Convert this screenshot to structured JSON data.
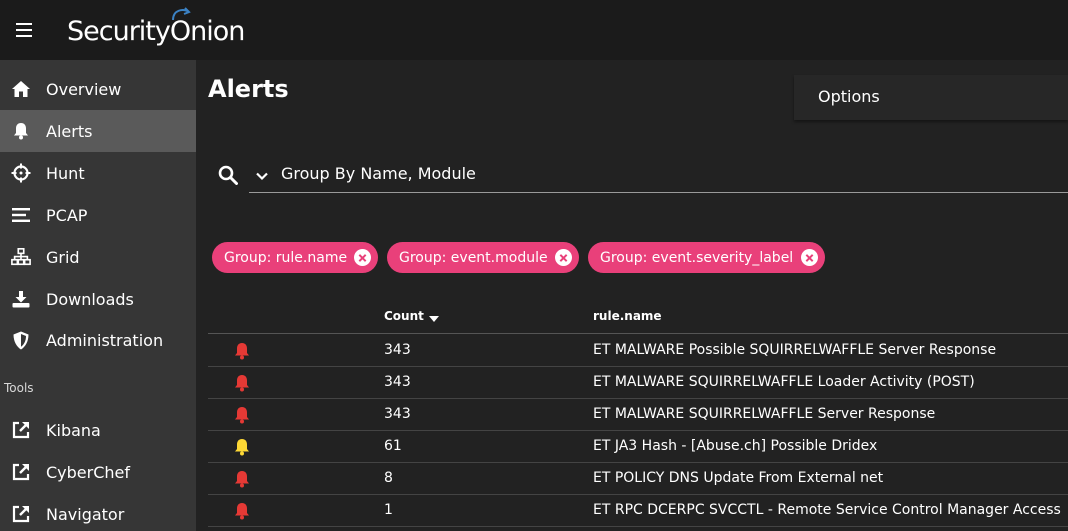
{
  "header": {
    "logo_text": "SecurityOnion",
    "menu_icon": "hamburger-menu-icon"
  },
  "sidebar": {
    "items": [
      {
        "label": "Overview",
        "icon": "home-icon"
      },
      {
        "label": "Alerts",
        "icon": "bell-icon",
        "active": true
      },
      {
        "label": "Hunt",
        "icon": "crosshair-icon"
      },
      {
        "label": "PCAP",
        "icon": "list-icon"
      },
      {
        "label": "Grid",
        "icon": "grid-network-icon"
      },
      {
        "label": "Downloads",
        "icon": "download-icon"
      },
      {
        "label": "Administration",
        "icon": "shield-icon"
      }
    ],
    "tools_label": "Tools",
    "tools": [
      {
        "label": "Kibana",
        "icon": "external-link-icon"
      },
      {
        "label": "CyberChef",
        "icon": "external-link-icon"
      },
      {
        "label": "Navigator",
        "icon": "external-link-icon"
      }
    ]
  },
  "main": {
    "title": "Alerts",
    "options_label": "Options",
    "query": "Group By Name, Module",
    "chips": [
      {
        "label": "Group: rule.name"
      },
      {
        "label": "Group: event.module"
      },
      {
        "label": "Group: event.severity_label"
      }
    ],
    "table": {
      "columns": {
        "count": "Count",
        "name": "rule.name"
      },
      "rows": [
        {
          "severity": "high",
          "count": "343",
          "name": "ET MALWARE Possible SQUIRRELWAFFLE Server Response"
        },
        {
          "severity": "high",
          "count": "343",
          "name": "ET MALWARE SQUIRRELWAFFLE Loader Activity (POST)"
        },
        {
          "severity": "high",
          "count": "343",
          "name": "ET MALWARE SQUIRRELWAFFLE Server Response"
        },
        {
          "severity": "medium",
          "count": "61",
          "name": "ET JA3 Hash - [Abuse.ch] Possible Dridex"
        },
        {
          "severity": "high",
          "count": "8",
          "name": "ET POLICY DNS Update From External net"
        },
        {
          "severity": "high",
          "count": "1",
          "name": "ET RPC DCERPC SVCCTL - Remote Service Control Manager Access"
        }
      ]
    }
  },
  "colors": {
    "accent": "#e9407a",
    "severity_high": "#e53935",
    "severity_medium": "#fdd835"
  }
}
